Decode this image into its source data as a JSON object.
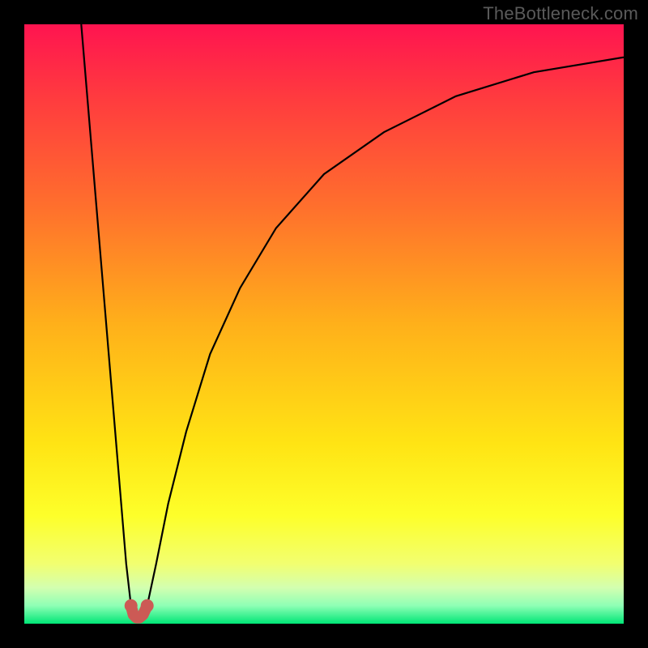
{
  "watermark": "TheBottleneck.com",
  "chart_data": {
    "type": "line",
    "title": "",
    "xlabel": "",
    "ylabel": "",
    "xlim": [
      0,
      100
    ],
    "ylim": [
      0,
      100
    ],
    "grid": false,
    "legend": false,
    "background": {
      "type": "vertical-gradient",
      "stops": [
        {
          "pos": 0.0,
          "color": "#ff1450"
        },
        {
          "pos": 0.12,
          "color": "#ff3a3f"
        },
        {
          "pos": 0.3,
          "color": "#ff6e2d"
        },
        {
          "pos": 0.5,
          "color": "#ffb01a"
        },
        {
          "pos": 0.7,
          "color": "#ffe414"
        },
        {
          "pos": 0.82,
          "color": "#fdff2a"
        },
        {
          "pos": 0.9,
          "color": "#f2ff70"
        },
        {
          "pos": 0.94,
          "color": "#d3ffb0"
        },
        {
          "pos": 0.97,
          "color": "#8effb5"
        },
        {
          "pos": 1.0,
          "color": "#00e676"
        }
      ]
    },
    "series": [
      {
        "name": "left-branch",
        "x": [
          9.5,
          10.0,
          11.0,
          12.0,
          13.0,
          14.0,
          15.0,
          16.0,
          17.0,
          17.8
        ],
        "y": [
          100,
          94,
          82,
          70,
          58,
          46,
          34,
          22,
          10,
          3
        ]
      },
      {
        "name": "right-branch",
        "x": [
          20.5,
          22,
          24,
          27,
          31,
          36,
          42,
          50,
          60,
          72,
          85,
          100
        ],
        "y": [
          3,
          10,
          20,
          32,
          45,
          56,
          66,
          75,
          82,
          88,
          92,
          94.5
        ]
      },
      {
        "name": "cusp",
        "x": [
          17.8,
          18.2,
          18.7,
          19.2,
          19.8,
          20.5
        ],
        "y": [
          3.0,
          1.5,
          1.0,
          1.0,
          1.5,
          3.0
        ]
      }
    ],
    "marker": {
      "name": "cusp-marker",
      "color": "#cc5a55",
      "points_x": [
        17.8,
        18.2,
        18.7,
        19.2,
        19.8,
        20.5
      ],
      "points_y": [
        3.0,
        1.5,
        1.0,
        1.0,
        1.5,
        3.0
      ]
    }
  }
}
